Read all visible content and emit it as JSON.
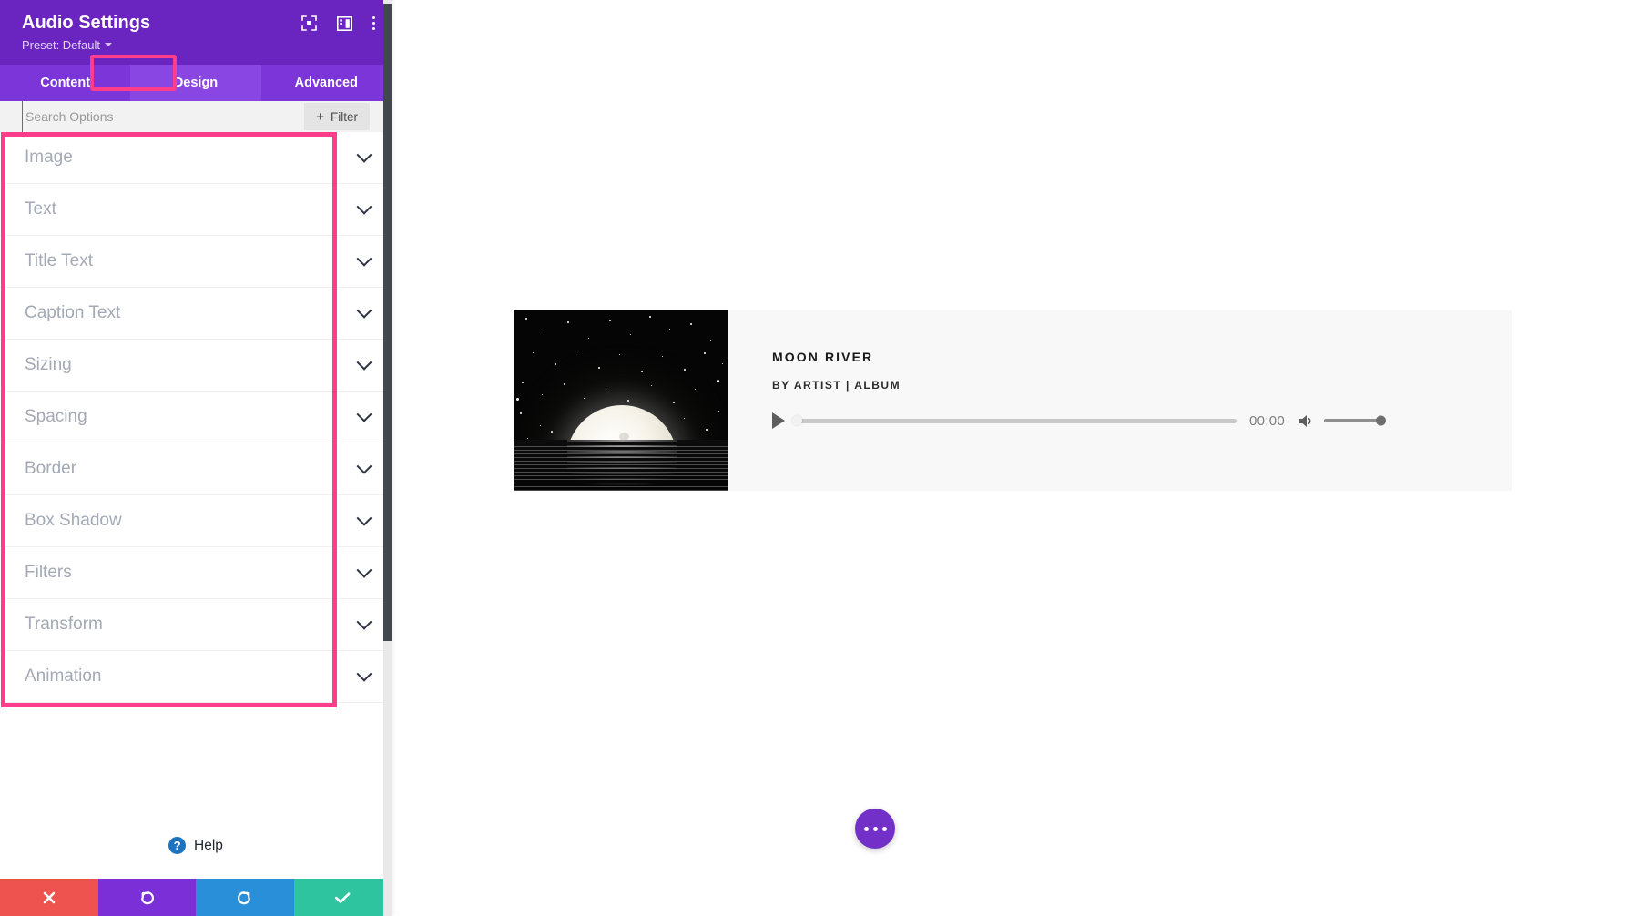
{
  "sidebar": {
    "title": "Audio Settings",
    "preset_label": "Preset: Default",
    "header_icons": [
      {
        "name": "focus-target-icon"
      },
      {
        "name": "panel-layout-icon"
      },
      {
        "name": "more-vertical-icon"
      }
    ],
    "tabs": [
      {
        "label": "Content",
        "active": false
      },
      {
        "label": "Design",
        "active": true
      },
      {
        "label": "Advanced",
        "active": false
      }
    ],
    "search": {
      "placeholder": "Search Options",
      "value": ""
    },
    "filter_button": {
      "label": "Filter",
      "plus": "+"
    },
    "sections": [
      {
        "label": "Image"
      },
      {
        "label": "Text"
      },
      {
        "label": "Title Text"
      },
      {
        "label": "Caption Text"
      },
      {
        "label": "Sizing"
      },
      {
        "label": "Spacing"
      },
      {
        "label": "Border"
      },
      {
        "label": "Box Shadow"
      },
      {
        "label": "Filters"
      },
      {
        "label": "Transform"
      },
      {
        "label": "Animation"
      }
    ],
    "help": {
      "label": "Help",
      "icon_glyph": "?"
    },
    "footer_buttons": [
      {
        "name": "cancel-button",
        "glyph": "✖",
        "color": "#ef5350"
      },
      {
        "name": "undo-button",
        "glyph": "↺",
        "color": "#7b2fd6"
      },
      {
        "name": "redo-button",
        "glyph": "↻",
        "color": "#2a8fd9"
      },
      {
        "name": "save-button",
        "glyph": "✔",
        "color": "#2ec4a0"
      }
    ],
    "colors": {
      "header_purple": "#6a24c0",
      "tabbar_purple": "#7b35d8",
      "active_tab_purple": "#8a46e3",
      "highlight_pink": "#ff3d8a"
    }
  },
  "canvas": {
    "audio_module": {
      "title": "MOON RIVER",
      "meta": "BY ARTIST | ALBUM",
      "time": "00:00",
      "play_icon": "play-icon",
      "volume_icon": "volume-icon",
      "progress_percent": 0,
      "volume_percent": 100
    },
    "fab": {
      "name": "page-settings-fab",
      "icon": "ellipsis-icon",
      "color": "#7230c9"
    }
  }
}
